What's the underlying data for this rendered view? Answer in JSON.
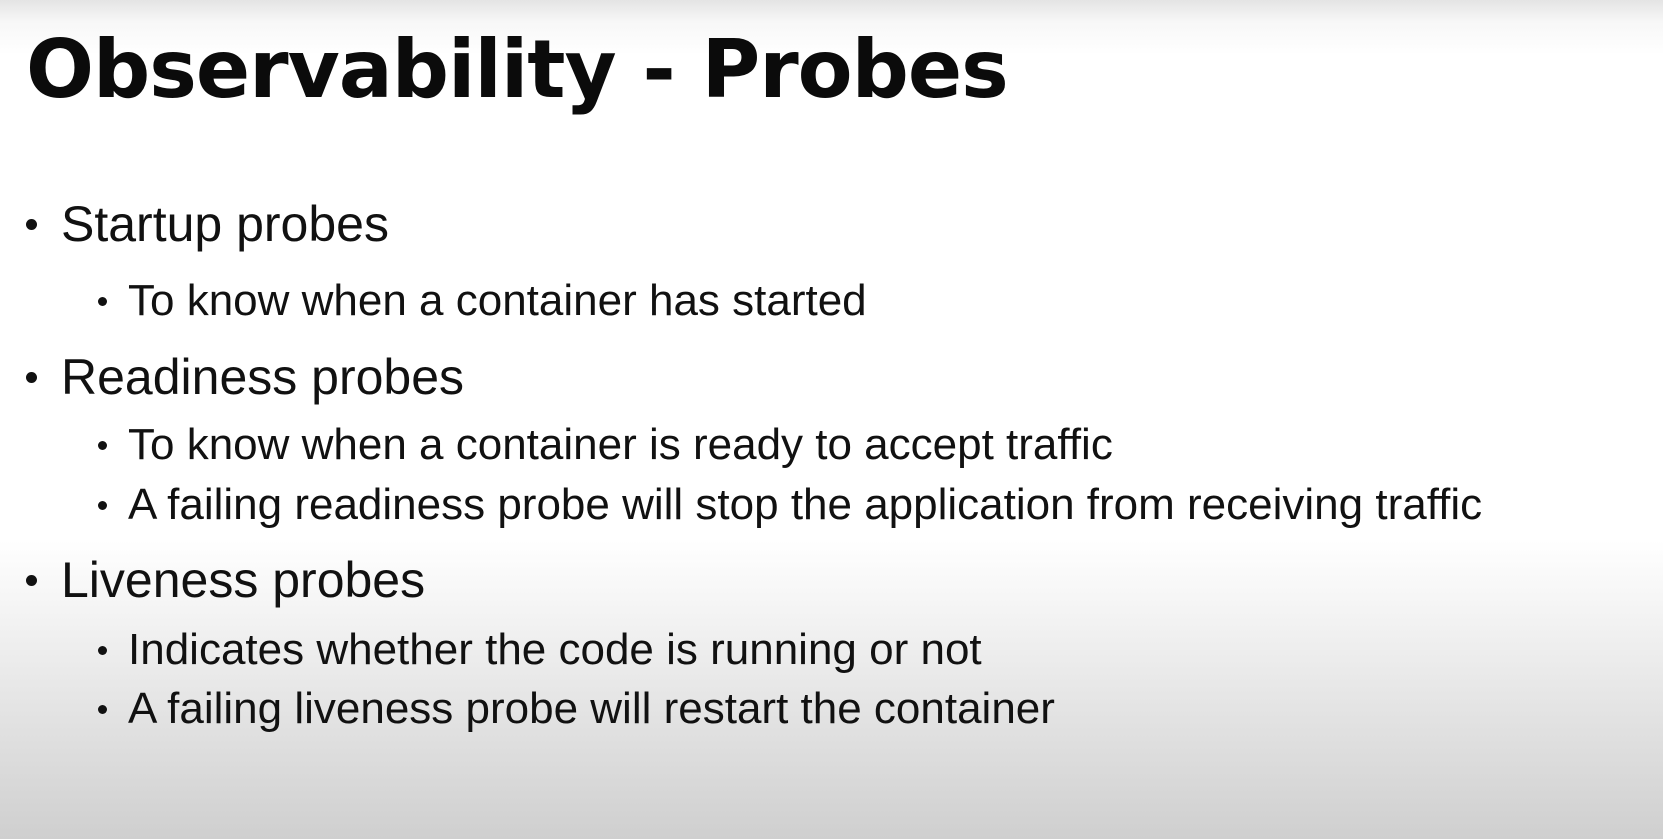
{
  "slide": {
    "title": "Observability - Probes",
    "bullets": [
      {
        "text": "Startup probes",
        "sub": [
          "To know when a container has started"
        ]
      },
      {
        "text": "Readiness probes",
        "sub": [
          "To know when a container is ready to accept traffic",
          "A failing readiness probe will stop the application from receiving traffic"
        ]
      },
      {
        "text": "Liveness probes",
        "sub": [
          "Indicates whether the code is running or not",
          "A failing liveness probe will restart the container"
        ]
      }
    ]
  }
}
